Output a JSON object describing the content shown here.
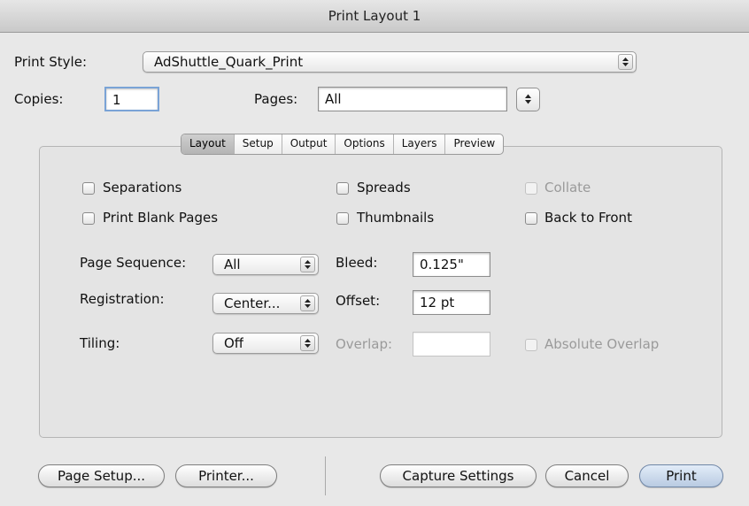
{
  "window": {
    "title": "Print Layout 1"
  },
  "header": {
    "print_style_label": "Print Style:",
    "print_style_value": "AdShuttle_Quark_Print",
    "copies_label": "Copies:",
    "copies_value": "1",
    "pages_label": "Pages:",
    "pages_value": "All"
  },
  "tabs": [
    {
      "label": "Layout",
      "active": true
    },
    {
      "label": "Setup"
    },
    {
      "label": "Output"
    },
    {
      "label": "Options"
    },
    {
      "label": "Layers"
    },
    {
      "label": "Preview"
    }
  ],
  "checkboxes": {
    "separations": {
      "label": "Separations",
      "checked": false,
      "enabled": true
    },
    "spreads": {
      "label": "Spreads",
      "checked": false,
      "enabled": true
    },
    "collate": {
      "label": "Collate",
      "checked": false,
      "enabled": false
    },
    "print_blank_pages": {
      "label": "Print Blank Pages",
      "checked": false,
      "enabled": true
    },
    "thumbnails": {
      "label": "Thumbnails",
      "checked": false,
      "enabled": true
    },
    "back_to_front": {
      "label": "Back to Front",
      "checked": false,
      "enabled": true
    },
    "absolute_overlap": {
      "label": "Absolute Overlap",
      "checked": false,
      "enabled": false
    }
  },
  "options": {
    "page_sequence_label": "Page Sequence:",
    "page_sequence_value": "All",
    "registration_label": "Registration:",
    "registration_value": "Center...",
    "tiling_label": "Tiling:",
    "tiling_value": "Off",
    "bleed_label": "Bleed:",
    "bleed_value": "0.125\"",
    "offset_label": "Offset:",
    "offset_value": "12 pt",
    "overlap_label": "Overlap:",
    "overlap_value": ""
  },
  "buttons": {
    "page_setup": "Page Setup...",
    "printer": "Printer...",
    "capture_settings": "Capture Settings",
    "cancel": "Cancel",
    "print": "Print"
  },
  "colors": {
    "default_button": "#b9cbe2",
    "window_bg": "#e8e8e8",
    "disabled_text": "#9a9a9a"
  }
}
